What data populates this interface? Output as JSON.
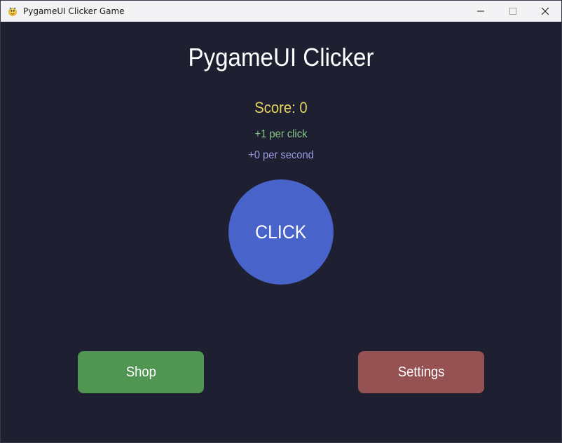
{
  "window": {
    "title": "PygameUI Clicker Game",
    "icon": "python-snake-icon",
    "controls": [
      "minimize-icon",
      "maximize-icon",
      "close-icon"
    ]
  },
  "game": {
    "title": "PygameUI Clicker",
    "score": "Score: 0",
    "per_click": "+1 per click",
    "per_second": "+0 per second",
    "click_label": "CLICK",
    "shop_label": "Shop",
    "settings_label": "Settings"
  },
  "colors": {
    "background": "#1e1f31",
    "score": "#e6d45c",
    "per_click": "#86c98a",
    "per_second": "#9b9be0",
    "click_button": "#4863c9",
    "shop_button": "#509652",
    "settings_button": "#965252"
  }
}
